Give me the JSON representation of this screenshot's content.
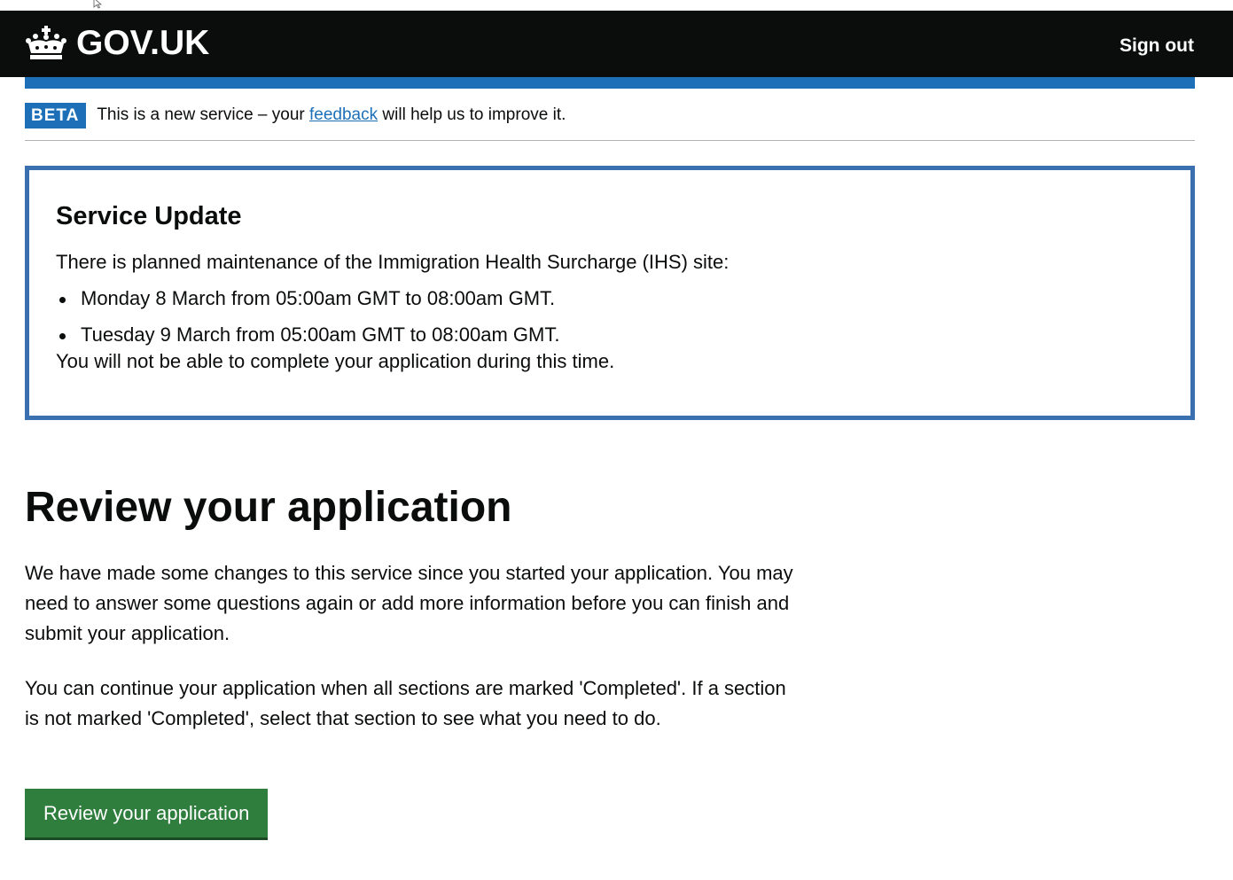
{
  "header": {
    "logo_text": "GOV.UK",
    "sign_out": "Sign out"
  },
  "phase_banner": {
    "tag": "BETA",
    "text_before": "This is a new service – your ",
    "link": "feedback",
    "text_after": " will help us to improve it."
  },
  "notice": {
    "title": "Service Update",
    "intro": "There is planned maintenance of the Immigration Health Surcharge (IHS) site:",
    "items": [
      "Monday 8 March from 05:00am GMT to 08:00am GMT.",
      "Tuesday 9 March from 05:00am GMT to 08:00am GMT."
    ],
    "outro": "You will not be able to complete your application during this time."
  },
  "main": {
    "title": "Review your application",
    "para1": "We have made some changes to this service since you started your application. You may need to answer some questions again or add more information before you can finish and submit your application.",
    "para2": "You can continue your application when all sections are marked 'Completed'. If a section is not marked 'Completed', select that section to see what you need to do.",
    "button": "Review your application"
  },
  "colors": {
    "header_bg": "#0b0c0c",
    "brand_blue": "#1d70b8",
    "notice_border": "#3a6fb0",
    "button_green": "#2f7e3e"
  },
  "icons": {
    "logo": "crown-icon",
    "cursor": "mouse-cursor-icon"
  }
}
